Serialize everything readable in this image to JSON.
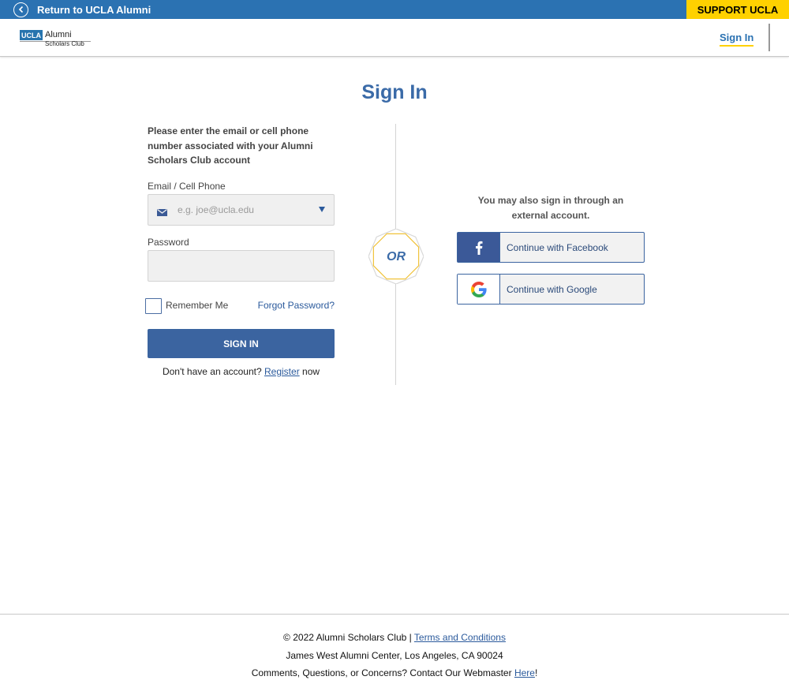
{
  "topbar": {
    "back_label": "Return to UCLA Alumni",
    "back_icon": "chevron-left-circle-icon",
    "support_label": "SUPPORT UCLA",
    "bar_color": "#2b72b2",
    "support_color": "#ffd100"
  },
  "header": {
    "logo": {
      "badge": "UCLA",
      "line1": "Alumni",
      "line2": "Scholars Club"
    },
    "nav_signin": "Sign In"
  },
  "page": {
    "title": "Sign In"
  },
  "signin_form": {
    "intro": "Please enter the email or cell phone number associated with your Alumni Scholars Club account",
    "email_label": "Email / Cell Phone",
    "email_placeholder": "e.g. joe@ucla.edu",
    "email_value": "",
    "email_icon": "mail-icon",
    "password_label": "Password",
    "password_value": "",
    "remember_label": "Remember Me",
    "remember_checked": false,
    "forgot_label": "Forgot Password?",
    "submit_label": "SIGN IN",
    "register_prefix": "Don't have an account?",
    "register_link": "Register",
    "register_suffix": "now"
  },
  "divider": {
    "or_label": "OR"
  },
  "external": {
    "intro": "You may also sign in through an external account.",
    "facebook_label": "Continue with Facebook",
    "facebook_icon": "facebook-icon",
    "google_label": "Continue with Google",
    "google_icon": "google-icon"
  },
  "footer": {
    "copyright": "© 2022 Alumni Scholars Club |",
    "terms_link": "Terms and Conditions",
    "address": "James West Alumni Center, Los Angeles, CA 90024",
    "contact_prefix": "Comments, Questions, or Concerns? Contact Our Webmaster",
    "contact_link": "Here",
    "contact_suffix": "!"
  },
  "colors": {
    "accent_blue": "#3b64a0",
    "title_blue": "#3b6ba8",
    "gold": "#ffd100",
    "facebook_blue": "#3b5998"
  }
}
